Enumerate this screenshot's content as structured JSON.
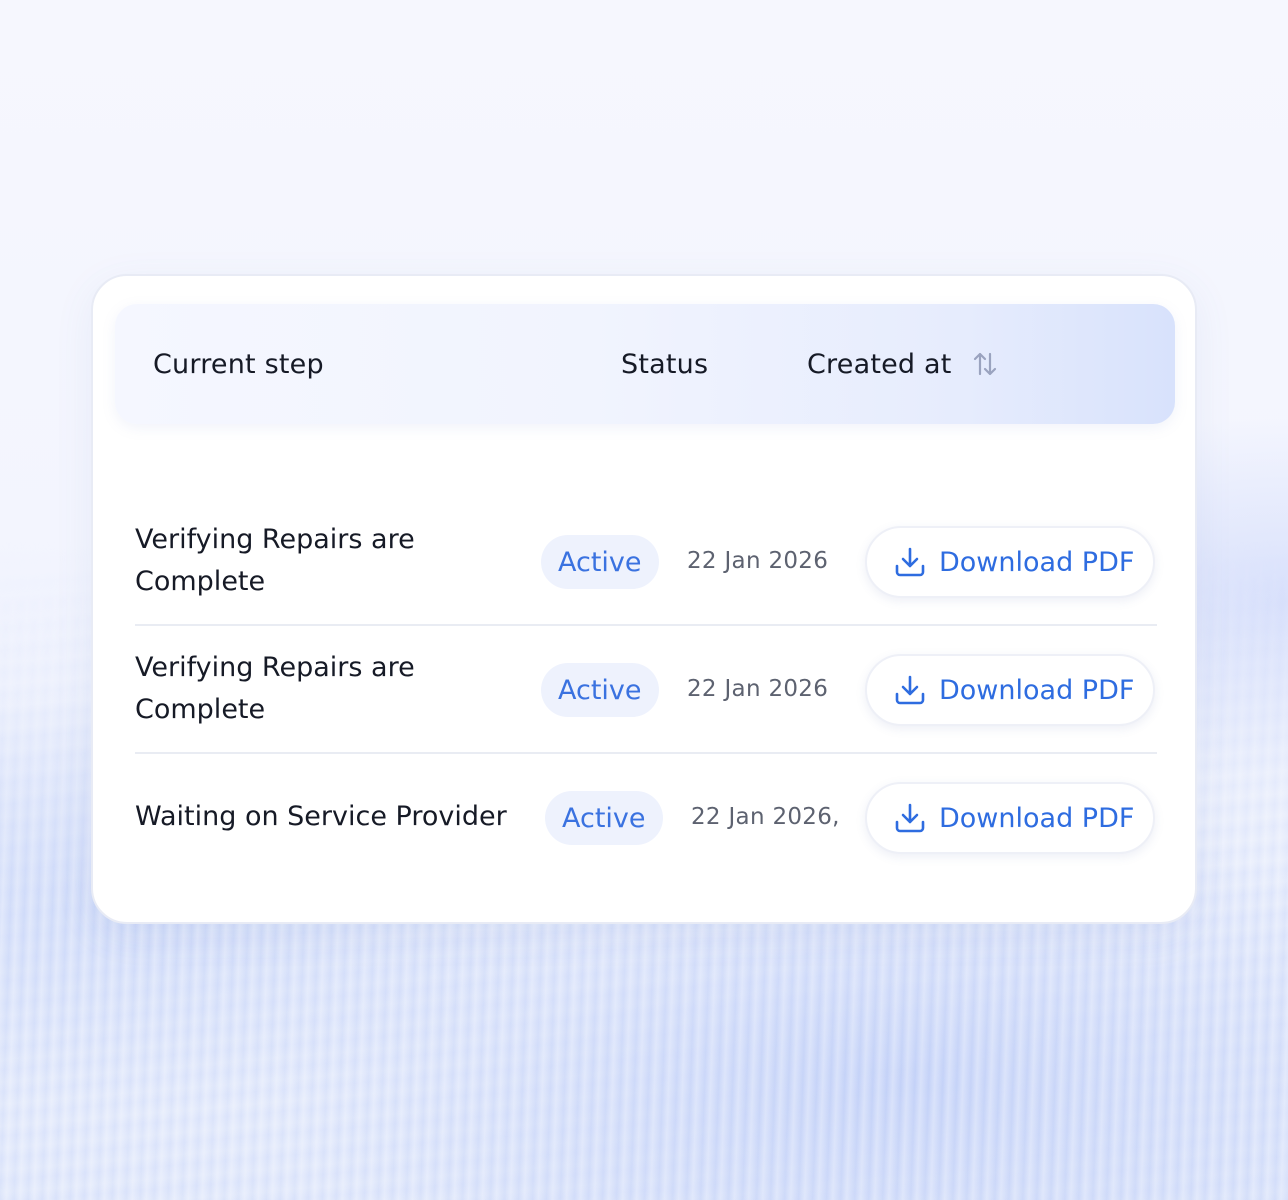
{
  "table": {
    "headers": {
      "current_step": "Current step",
      "status": "Status",
      "created_at": "Created at"
    },
    "rows": [
      {
        "step": "Verifying Repairs are Complete",
        "status": "Active",
        "created": "22 Jan 2026",
        "action": "Download PDF"
      },
      {
        "step": "Verifying Repairs are Complete",
        "status": "Active",
        "created": "22 Jan 2026",
        "action": "Download PDF"
      },
      {
        "step": "Waiting on Service Provider",
        "status": "Active",
        "created": "22 Jan 2026,",
        "action": "Download PDF"
      }
    ]
  },
  "icons": {
    "sort": "sort-arrows-icon",
    "download": "download-icon"
  },
  "colors": {
    "accent": "#2e6ce0",
    "badge_bg": "#eef2fd",
    "badge_text": "#3a72e0"
  }
}
